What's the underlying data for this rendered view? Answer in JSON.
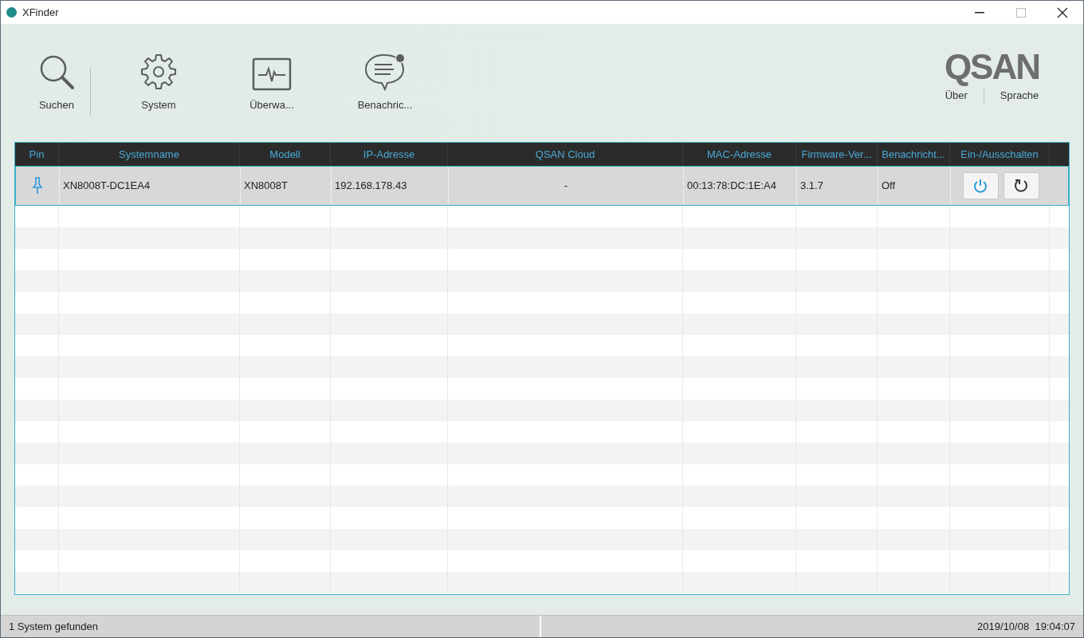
{
  "window": {
    "title": "XFinder"
  },
  "toolbar": [
    {
      "kind": "search",
      "label": "Suchen"
    },
    {
      "kind": "system",
      "label": "System"
    },
    {
      "kind": "monitor",
      "label": "Überwa..."
    },
    {
      "kind": "notify",
      "label": "Benachric..."
    }
  ],
  "brand": {
    "logo": "QSAN",
    "links": [
      "Über",
      "Sprache"
    ]
  },
  "table": {
    "columns": [
      "Pin",
      "Systemname",
      "Modell",
      "IP-Adresse",
      "QSAN Cloud",
      "MAC-Adresse",
      "Firmware-Ver...",
      "Benachricht...",
      "Ein-/Ausschalten"
    ],
    "rows": [
      {
        "selected": true,
        "system_name": "XN8008T-DC1EA4",
        "model": "XN8008T",
        "ip": "192.168.178.43",
        "cloud": "-",
        "mac": "00:13:78:DC:1E:A4",
        "firmware": "3.1.7",
        "notifications": "Off"
      }
    ]
  },
  "status_bar": {
    "message": "1 System gefunden",
    "timestamp": "2019/10/08  19:04:07"
  }
}
